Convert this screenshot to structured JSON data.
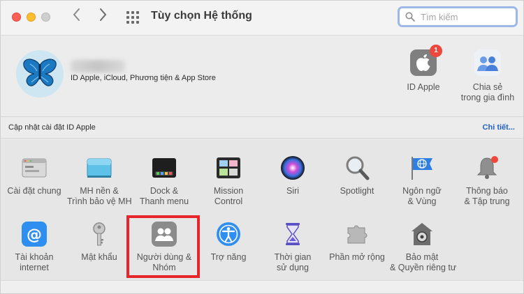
{
  "window": {
    "title": "Tùy chọn Hệ thống",
    "search_placeholder": "Tìm kiếm"
  },
  "apple_id": {
    "subtitle": "ID Apple, iCloud, Phương tiện & App Store",
    "update_text": "Cập nhật cài đặt ID Apple",
    "details_link": "Chi tiết...",
    "top_items": [
      {
        "label": "ID Apple",
        "icon": "apple-id-icon",
        "badge": "1"
      },
      {
        "label_lines": [
          "Chia sẻ",
          "trong gia đình"
        ],
        "icon": "family-sharing-icon"
      }
    ]
  },
  "prefs": {
    "row1": [
      {
        "lines": [
          "Cài đặt chung",
          ""
        ],
        "icon": "general-icon"
      },
      {
        "lines": [
          "MH nền &",
          "Trình bảo vệ MH"
        ],
        "icon": "desktop-screensaver-icon"
      },
      {
        "lines": [
          "Dock &",
          "Thanh menu"
        ],
        "icon": "dock-icon"
      },
      {
        "lines": [
          "Mission",
          "Control"
        ],
        "icon": "mission-control-icon"
      },
      {
        "lines": [
          "Siri",
          ""
        ],
        "icon": "siri-icon"
      },
      {
        "lines": [
          "Spotlight",
          ""
        ],
        "icon": "spotlight-icon"
      },
      {
        "lines": [
          "Ngôn ngữ",
          "& Vùng"
        ],
        "icon": "language-region-icon"
      },
      {
        "lines": [
          "Thông báo",
          "& Tập trung"
        ],
        "icon": "notifications-icon"
      }
    ],
    "row2": [
      {
        "lines": [
          "Tài khoản",
          "internet"
        ],
        "icon": "internet-accounts-icon"
      },
      {
        "lines": [
          "Mật khẩu",
          ""
        ],
        "icon": "passwords-icon"
      },
      {
        "lines": [
          "Người dùng &",
          "Nhóm"
        ],
        "icon": "users-groups-icon"
      },
      {
        "lines": [
          "Trợ năng",
          ""
        ],
        "icon": "accessibility-icon"
      },
      {
        "lines": [
          "Thời gian",
          "sử dụng"
        ],
        "icon": "screen-time-icon"
      },
      {
        "lines": [
          "Phần mở rộng",
          ""
        ],
        "icon": "extensions-icon"
      },
      {
        "lines": [
          "Bảo mật",
          "& Quyền riêng tư"
        ],
        "icon": "security-privacy-icon"
      }
    ]
  },
  "colors": {
    "highlight": "#e7262b",
    "link": "#2463c9",
    "badge": "#f0473d"
  }
}
